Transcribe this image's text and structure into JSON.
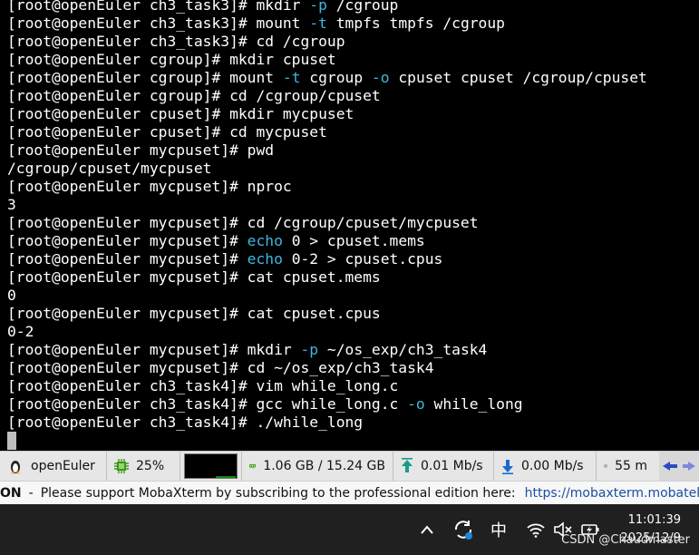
{
  "terminal": {
    "lines": [
      {
        "prompt": "[root@openEuler ch3_task3]# ",
        "cmd": "mkdir ",
        "hl": "-p",
        "rest": " /cgroup"
      },
      {
        "prompt": "[root@openEuler ch3_task3]# ",
        "cmd": "mount ",
        "hl": "-t",
        "rest": " tmpfs tmpfs /cgroup"
      },
      {
        "prompt": "[root@openEuler ch3_task3]# ",
        "cmd": "cd /cgroup",
        "hl": "",
        "rest": ""
      },
      {
        "prompt": "[root@openEuler cgroup]# ",
        "cmd": "mkdir cpuset",
        "hl": "",
        "rest": ""
      },
      {
        "prompt": "[root@openEuler cgroup]# ",
        "cmd": "mount ",
        "hl": "-t",
        "rest": " cgroup ",
        "hl2": "-o",
        "rest2": " cpuset cpuset /cgroup/cpuset"
      },
      {
        "prompt": "[root@openEuler cgroup]# ",
        "cmd": "cd /cgroup/cpuset",
        "hl": "",
        "rest": ""
      },
      {
        "prompt": "[root@openEuler cpuset]# ",
        "cmd": "mkdir mycpuset",
        "hl": "",
        "rest": ""
      },
      {
        "prompt": "[root@openEuler cpuset]# ",
        "cmd": "cd mycpuset",
        "hl": "",
        "rest": ""
      },
      {
        "prompt": "[root@openEuler mycpuset]# ",
        "cmd": "pwd",
        "hl": "",
        "rest": ""
      },
      {
        "prompt": "",
        "cmd": "/cgroup/cpuset/mycpuset",
        "hl": "",
        "rest": ""
      },
      {
        "prompt": "[root@openEuler mycpuset]# ",
        "cmd": "nproc",
        "hl": "",
        "rest": ""
      },
      {
        "prompt": "",
        "cmd": "3",
        "hl": "",
        "rest": ""
      },
      {
        "prompt": "[root@openEuler mycpuset]# ",
        "cmd": "cd /cgroup/cpuset/mycpuset",
        "hl": "",
        "rest": ""
      },
      {
        "prompt": "[root@openEuler mycpuset]# ",
        "cmd": "",
        "hl": "echo",
        "rest": " 0 > cpuset.mems"
      },
      {
        "prompt": "[root@openEuler mycpuset]# ",
        "cmd": "",
        "hl": "echo",
        "rest": " 0-2 > cpuset.cpus"
      },
      {
        "prompt": "[root@openEuler mycpuset]# ",
        "cmd": "cat cpuset.mems",
        "hl": "",
        "rest": ""
      },
      {
        "prompt": "",
        "cmd": "0",
        "hl": "",
        "rest": ""
      },
      {
        "prompt": "[root@openEuler mycpuset]# ",
        "cmd": "cat cpuset.cpus",
        "hl": "",
        "rest": ""
      },
      {
        "prompt": "",
        "cmd": "0-2",
        "hl": "",
        "rest": ""
      },
      {
        "prompt": "[root@openEuler mycpuset]# ",
        "cmd": "mkdir ",
        "hl": "-p",
        "rest": " ~/os_exp/ch3_task4"
      },
      {
        "prompt": "[root@openEuler mycpuset]# ",
        "cmd": "cd ~/os_exp/ch3_task4",
        "hl": "",
        "rest": ""
      },
      {
        "prompt": "[root@openEuler ch3_task4]# ",
        "cmd": "vim while_long.c",
        "hl": "",
        "rest": ""
      },
      {
        "prompt": "[root@openEuler ch3_task4]# ",
        "cmd": "gcc while_long.c ",
        "hl": "-o",
        "rest": " while_long"
      },
      {
        "prompt": "[root@openEuler ch3_task4]# ",
        "cmd": "./while_long",
        "hl": "",
        "rest": ""
      }
    ]
  },
  "statusbar": {
    "host_label": "openEuler",
    "cpu_percent": "25%",
    "cpu_level": 0.25,
    "memory": "1.06 GB / 15.24 GB",
    "upload": "0.01 Mb/s",
    "download": "0.00 Mb/s",
    "disk": "55 m"
  },
  "notice": {
    "prefix": "ON",
    "message": "Please support MobaXterm by subscribing to the professional edition here:",
    "link": "https://mobaxterm.mobatek.net"
  },
  "taskbar": {
    "ime": "中",
    "time": "11:01:39",
    "date": "2025/12/9",
    "watermark": "CSDN @Chaudmaster"
  },
  "colors": {
    "terminal_bg": "#000000",
    "terminal_fg": "#ffffff",
    "option_highlight": "#3fb6e0",
    "statusbar_bg": "#e6e6e6",
    "taskbar_bg": "#202020"
  }
}
